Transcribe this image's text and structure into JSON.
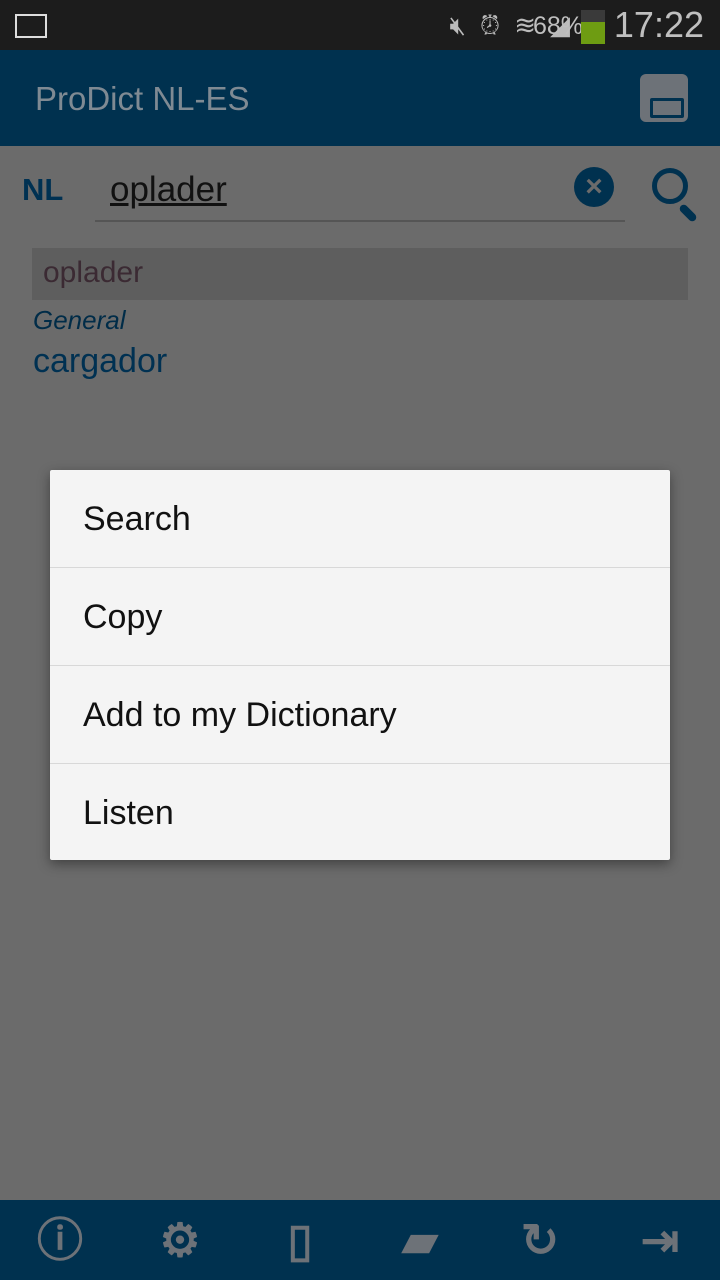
{
  "status_bar": {
    "battery": "68%",
    "time": "17:22",
    "battery_level": 0.68,
    "battery_color": "#6e9c12"
  },
  "app_bar": {
    "title": "ProDict NL-ES",
    "background": "#00314f"
  },
  "search": {
    "language": "NL",
    "value": "oplader"
  },
  "result": {
    "headword": "oplader",
    "category": "General",
    "translation": "cargador"
  },
  "context_menu": {
    "items": [
      {
        "label": "Search"
      },
      {
        "label": "Copy"
      },
      {
        "label": "Add to my Dictionary"
      },
      {
        "label": "Listen"
      }
    ]
  },
  "bottom_bar": {
    "icons": [
      "info-icon",
      "settings-icon",
      "bookmark-book-icon",
      "chat-icon",
      "history-icon",
      "exit-icon"
    ]
  }
}
